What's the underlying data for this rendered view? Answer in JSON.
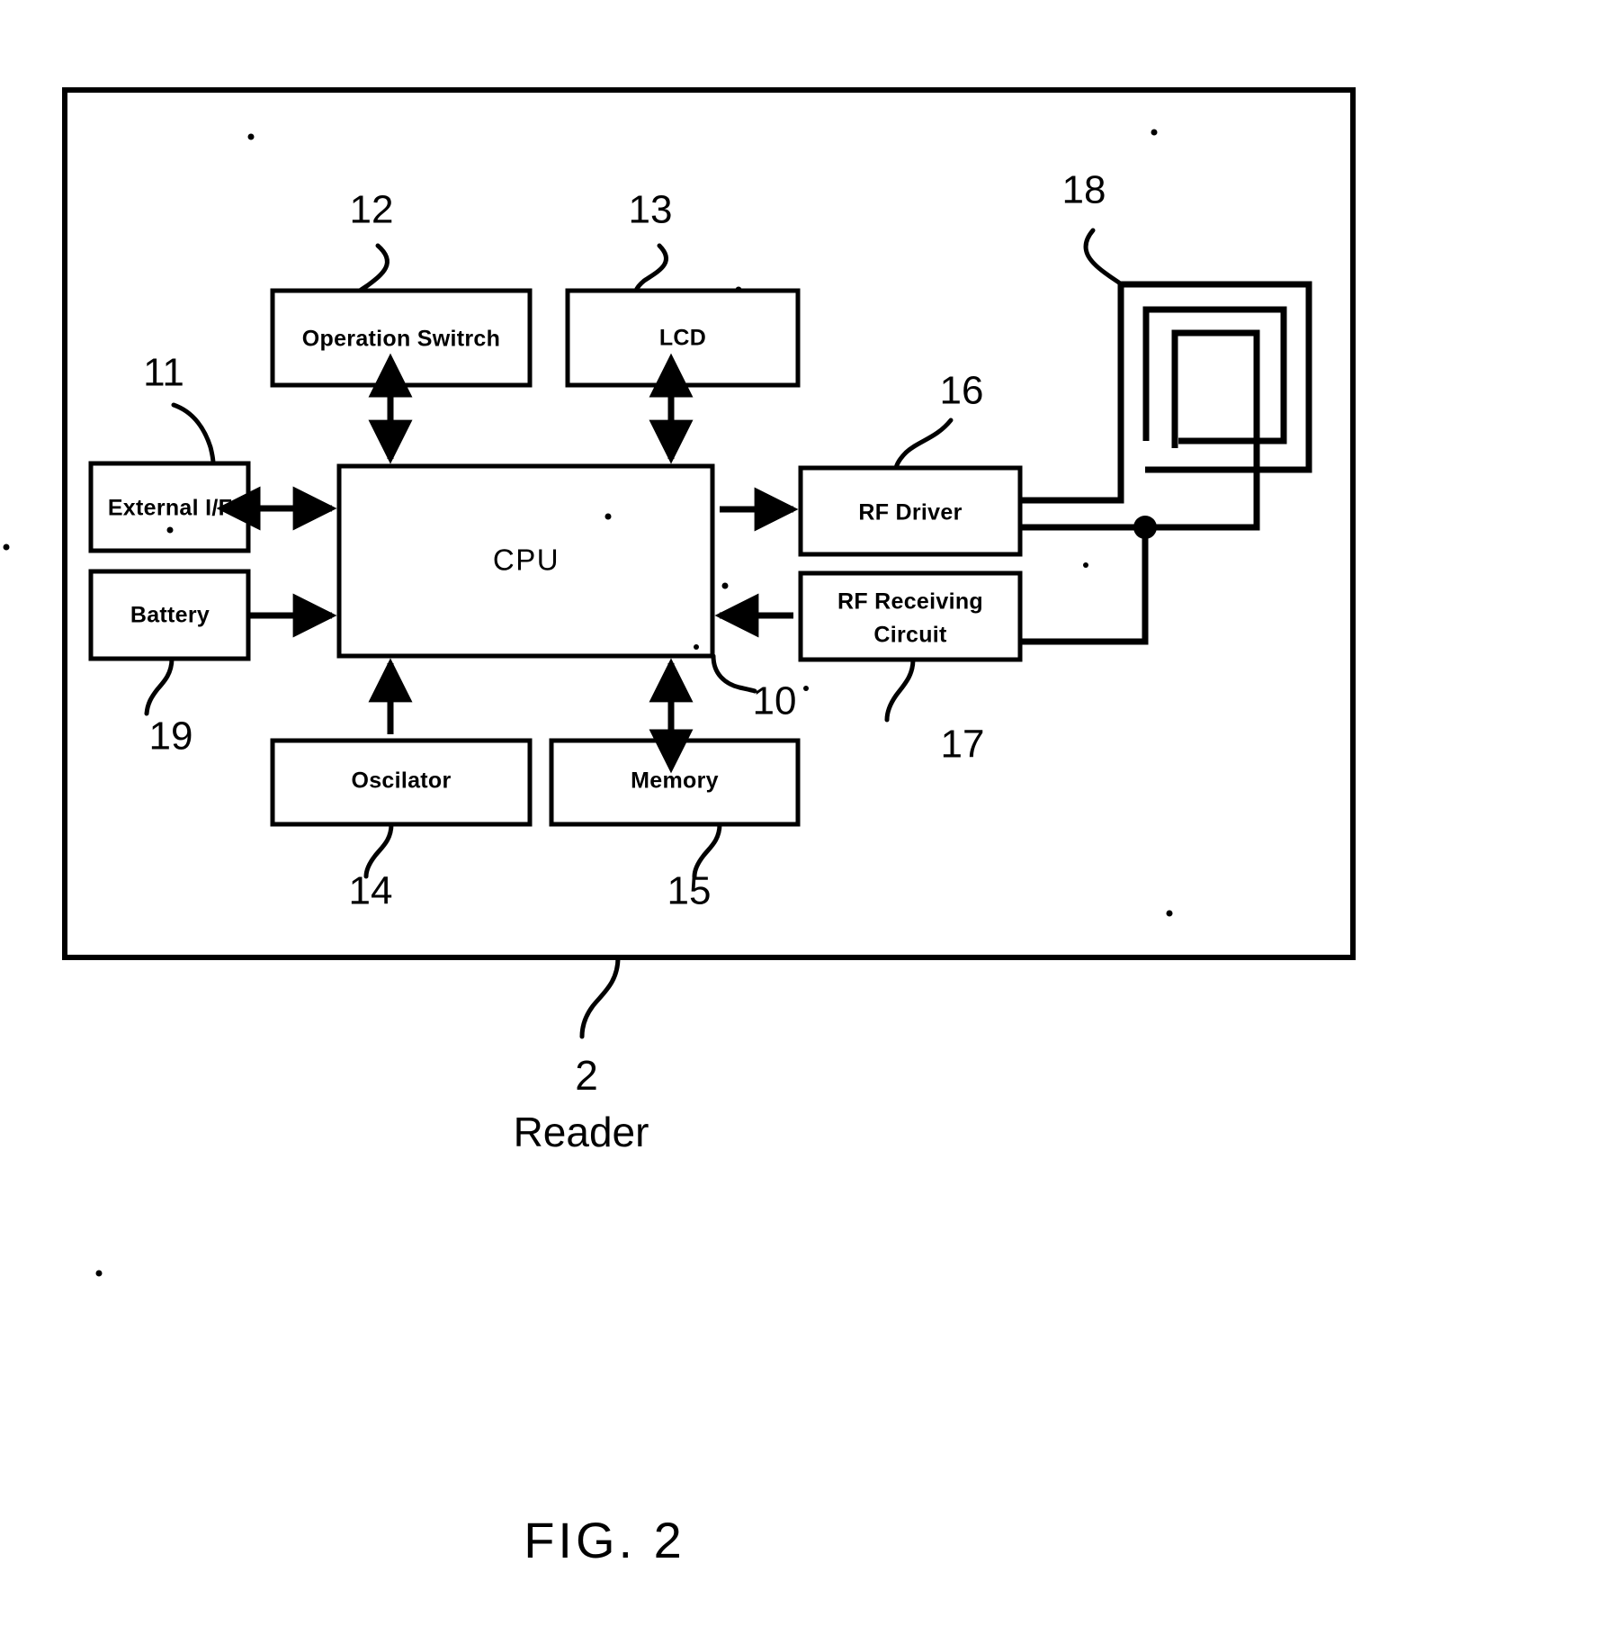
{
  "figure": {
    "title": "FIG. 2",
    "caption": "Reader",
    "caption_ref": "2"
  },
  "blocks": [
    {
      "id": "operation_switch",
      "label": "Operation Switrch",
      "ref": "12"
    },
    {
      "id": "lcd",
      "label": "LCD",
      "ref": "13"
    },
    {
      "id": "external_if",
      "label": "External I/F",
      "ref": "11"
    },
    {
      "id": "battery",
      "label": "Battery",
      "ref": "19"
    },
    {
      "id": "cpu",
      "label": "CPU",
      "ref": "10"
    },
    {
      "id": "rf_driver",
      "label": "RF Driver",
      "ref": "16"
    },
    {
      "id": "rf_receiving",
      "label_line1": "RF Receiving",
      "label_line2": "Circuit",
      "ref": "17"
    },
    {
      "id": "oscillator",
      "label": "Oscilator",
      "ref": "14"
    },
    {
      "id": "memory",
      "label": "Memory",
      "ref": "15"
    },
    {
      "id": "antenna_coil",
      "label": "",
      "ref": "18"
    }
  ],
  "refs": {
    "r10": "10",
    "r11": "11",
    "r12": "12",
    "r13": "13",
    "r14": "14",
    "r15": "15",
    "r16": "16",
    "r17": "17",
    "r18": "18",
    "r19": "19"
  },
  "labels": {
    "operation_switch": "Operation Switrch",
    "lcd": "LCD",
    "external_if": "External I/F",
    "battery": "Battery",
    "cpu": "CPU",
    "rf_driver": "RF Driver",
    "rf_receiving_1": "RF Receiving",
    "rf_receiving_2": "Circuit",
    "oscillator": "Oscilator",
    "memory": "Memory"
  },
  "colors": {
    "ink": "#000000",
    "paper": "#ffffff"
  }
}
